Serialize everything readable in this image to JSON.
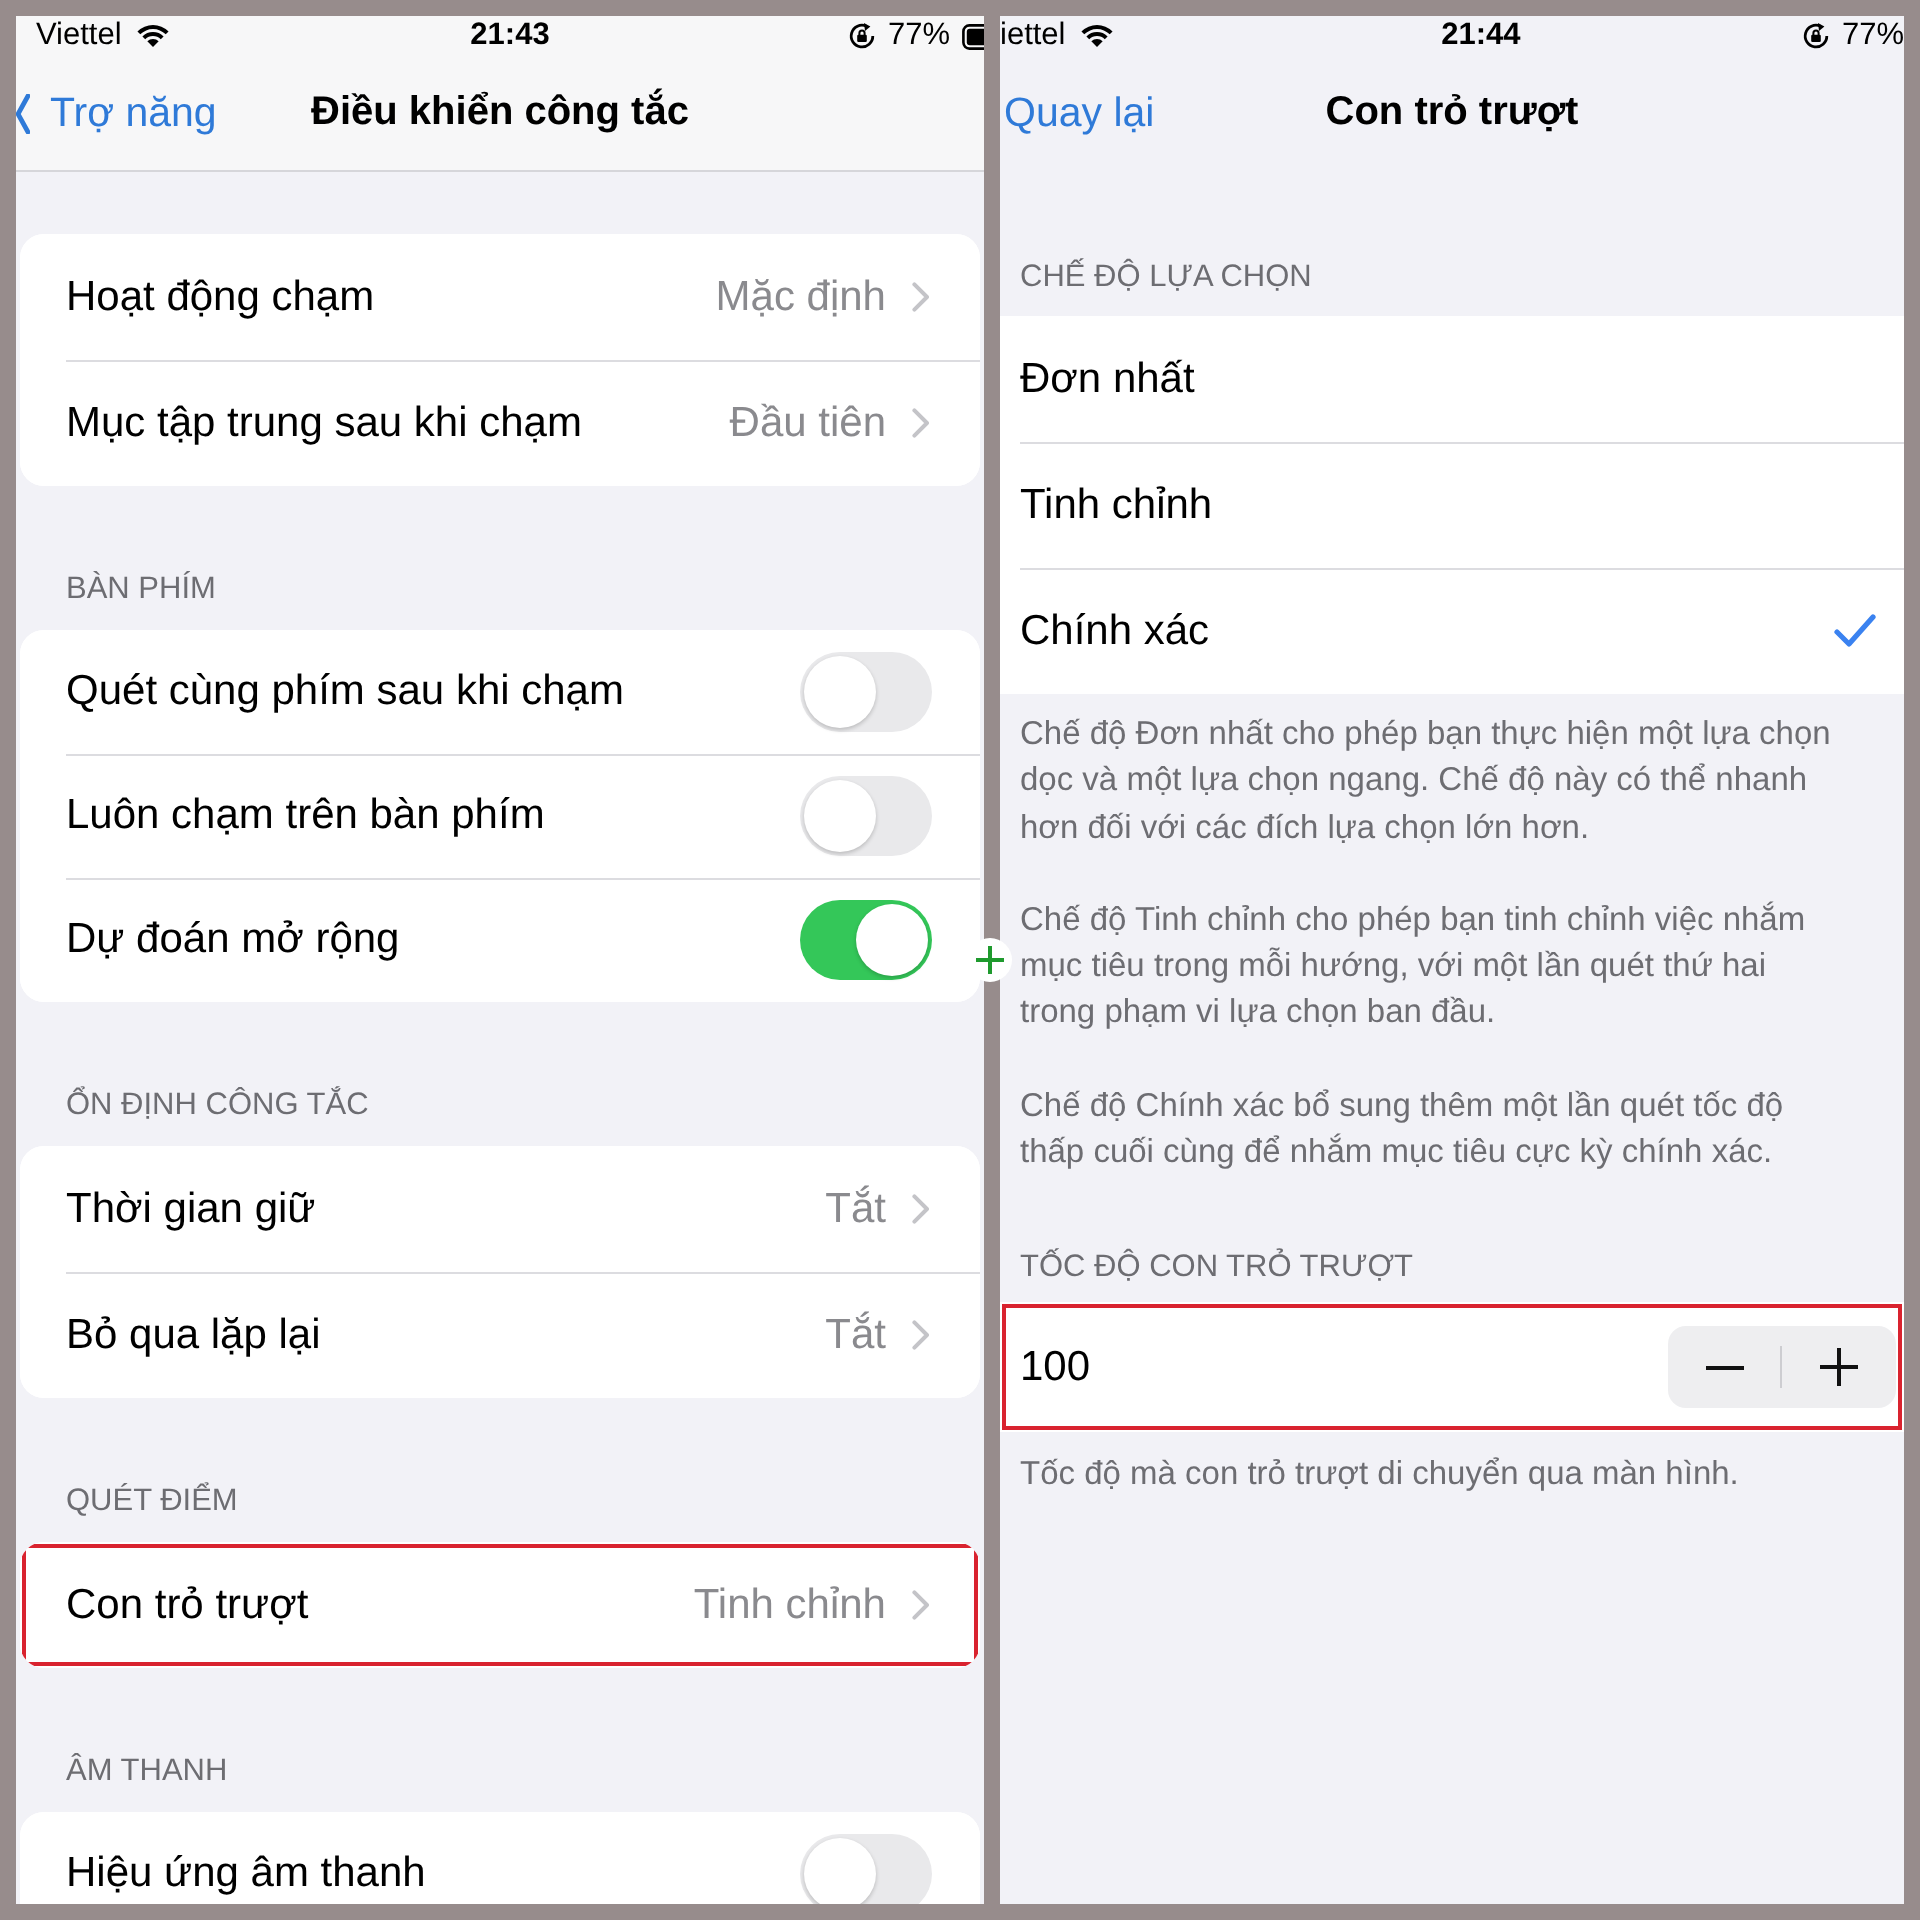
{
  "left_screen": {
    "status_bar": {
      "carrier": "Viettel",
      "time": "21:43",
      "battery": "77%"
    },
    "nav_bar": {
      "back": "Trợ năng",
      "title": "Điều khiển công tắc"
    },
    "sections": [
      {
        "rows": [
          {
            "kind": "link",
            "label": "Hoạt động chạm",
            "value": "Mặc định",
            "highlighted": false
          },
          {
            "kind": "link",
            "label": "Mục tập trung sau khi chạm",
            "value": "Đầu tiên",
            "highlighted": false
          }
        ]
      },
      {
        "header": "BÀN PHÍM",
        "rows": [
          {
            "kind": "toggle",
            "label": "Quét cùng phím sau khi chạm",
            "on": false,
            "highlighted": false
          },
          {
            "kind": "toggle",
            "label": "Luôn chạm trên bàn phím",
            "on": false,
            "highlighted": false
          },
          {
            "kind": "toggle",
            "label": "Dự đoán mở rộng",
            "on": true,
            "highlighted": false
          }
        ]
      },
      {
        "header": "ỔN ĐỊNH CÔNG TẮC",
        "rows": [
          {
            "kind": "link",
            "label": "Thời gian giữ",
            "value": "Tắt",
            "highlighted": false
          },
          {
            "kind": "link",
            "label": "Bỏ qua lặp lại",
            "value": "Tắt",
            "highlighted": false
          }
        ]
      },
      {
        "header": "QUÉT ĐIỂM",
        "rows": [
          {
            "kind": "link",
            "label": "Con trỏ trượt",
            "value": "Tinh chỉnh",
            "highlighted": true
          }
        ]
      },
      {
        "header": "ÂM THANH",
        "rows": [
          {
            "kind": "toggle",
            "label": "Hiệu ứng âm thanh",
            "on": false,
            "highlighted": false
          }
        ]
      }
    ]
  },
  "right_screen": {
    "status_bar": {
      "carrier": "iettel",
      "time": "21:44",
      "battery": "77%"
    },
    "nav_bar": {
      "back": "Quay lại",
      "title": "Con trỏ trượt"
    },
    "selection_mode": {
      "header": "CHẾ ĐỘ LỰA CHỌN",
      "options": [
        {
          "label": "Đơn nhất",
          "selected": false
        },
        {
          "label": "Tinh chỉnh",
          "selected": false
        },
        {
          "label": "Chính xác",
          "selected": true
        }
      ],
      "notes": [
        "Chế độ Đơn nhất cho phép bạn thực hiện một lựa chọn\ndọc và một lựa chọn ngang. Chế độ này có thể nhanh\nhơn đối với các đích lựa chọn lớn hơn.",
        "Chế độ Tinh chỉnh cho phép bạn tinh chỉnh việc nhắm\nmục tiêu trong mỗi hướng, với một lần quét thứ hai\ntrong phạm vi lựa chọn ban đầu.",
        "Chế độ Chính xác bổ sung thêm một lần quét tốc độ\nthấp cuối cùng để nhắm mục tiêu cực kỳ chính xác."
      ]
    },
    "pointer_speed": {
      "header": "TỐC ĐỘ CON TRỎ TRƯỢT",
      "value": "100",
      "highlighted": true,
      "note": "Tốc độ mà con trỏ trượt di chuyển qua màn hình."
    }
  }
}
